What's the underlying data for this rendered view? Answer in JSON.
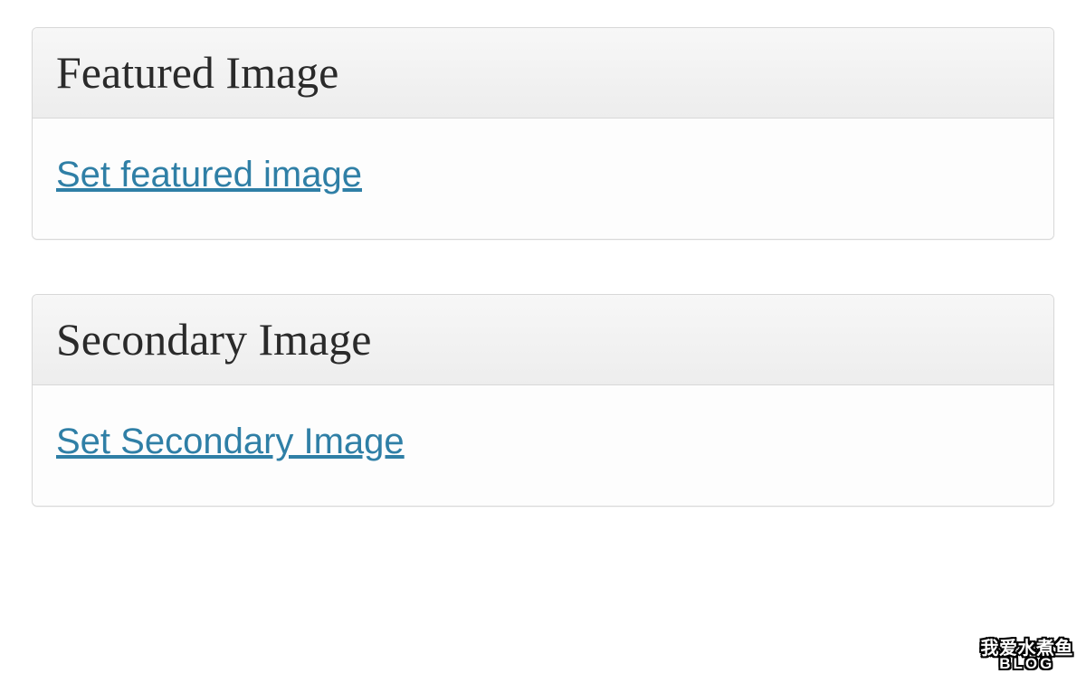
{
  "metaboxes": [
    {
      "title": "Featured Image",
      "link": "Set featured image"
    },
    {
      "title": "Secondary Image",
      "link": "Set Secondary Image"
    }
  ],
  "watermark": {
    "line1": "我爱水煮鱼",
    "line2": "BLOG"
  }
}
